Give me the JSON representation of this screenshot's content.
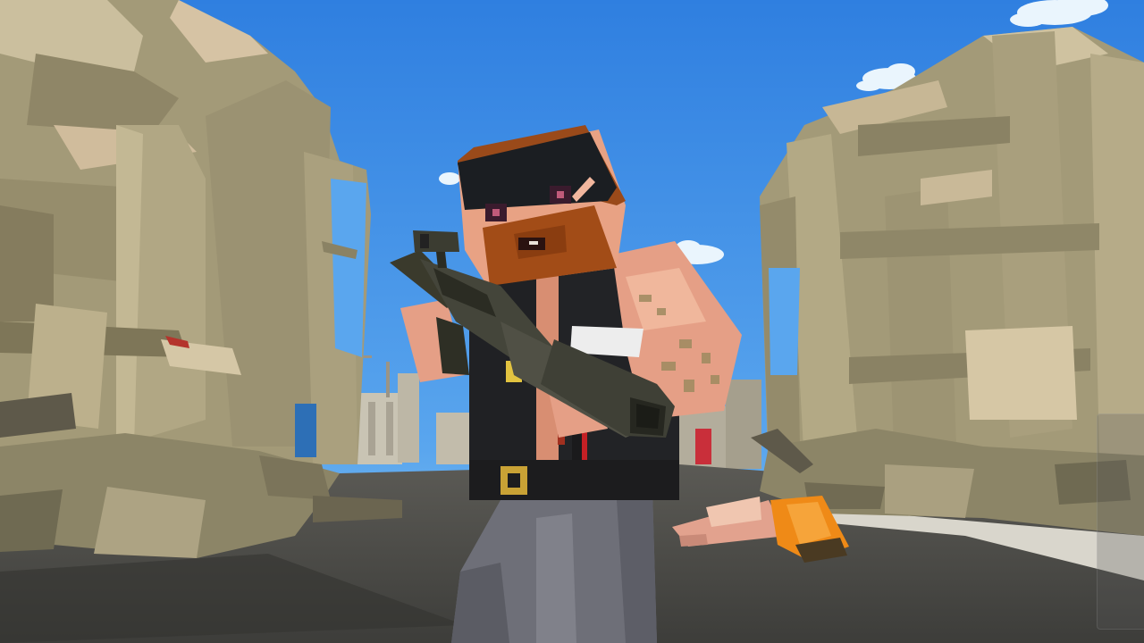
{
  "scene": {
    "setting": "ruined-city-street",
    "sky_top_color": "#2f7fe0",
    "sky_bottom_color": "#7cc0f2",
    "ruin_color": "#a39a78",
    "ground_color": "#4b4b47"
  },
  "player": {
    "character": "blocky-bearded-soldier",
    "weapon": "rifle-with-scope-and-silencer"
  },
  "enemy": {
    "state": "defeated",
    "weapon": "orange-backpack"
  },
  "hud": {
    "side_panel": "right-edge-control-panel"
  }
}
